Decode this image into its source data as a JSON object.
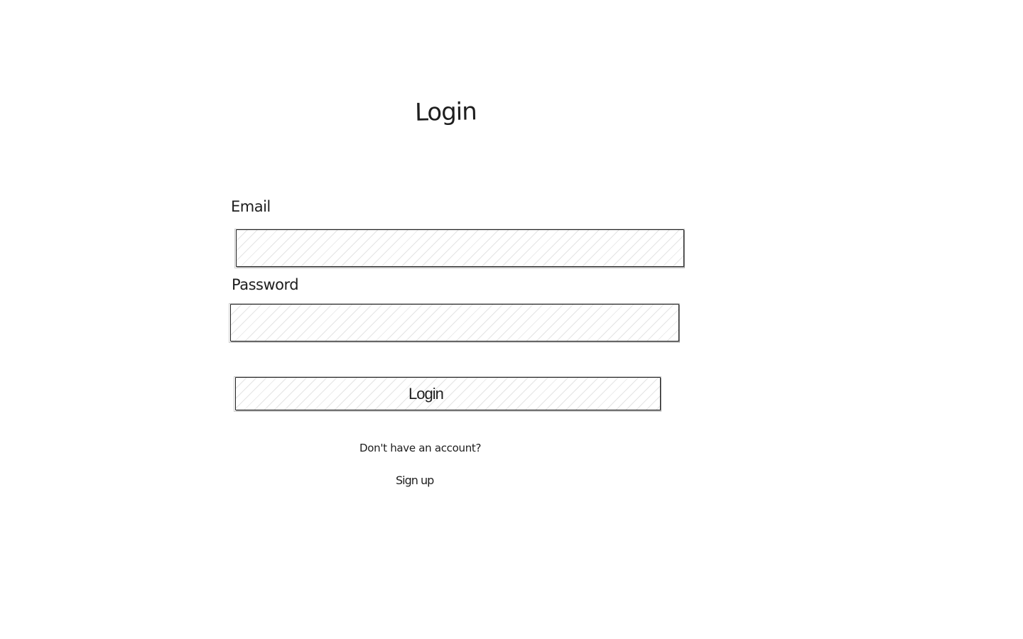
{
  "page": {
    "title": "Login"
  },
  "form": {
    "email": {
      "label": "Email",
      "value": "",
      "placeholder": ""
    },
    "password": {
      "label": "Password",
      "value": "",
      "placeholder": ""
    },
    "submit_label": "Login"
  },
  "footer": {
    "account_prompt": "Don't have an account?",
    "signup_label": "Sign up"
  },
  "colors": {
    "ink": "#1e1e1e",
    "hatch": "#bebebe",
    "background": "#ffffff"
  }
}
